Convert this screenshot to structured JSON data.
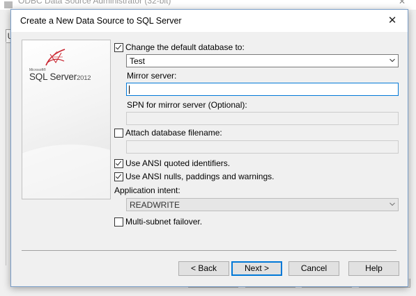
{
  "background_window": {
    "title": "ODBC Data Source Administrator (32-bit)",
    "tab_glyph": "U",
    "close_glyph": "✕"
  },
  "dialog": {
    "title": "Create a New Data Source to SQL Server",
    "close_glyph": "✕"
  },
  "logo": {
    "small": "Microsoft®",
    "main": "SQL Server",
    "year": "2012",
    "icon": "sql-server-logo-icon"
  },
  "form": {
    "change_default_db": {
      "label": "Change the default database to:",
      "checked": true
    },
    "database": {
      "value": "Test"
    },
    "mirror_server": {
      "label": "Mirror server:",
      "value": ""
    },
    "spn": {
      "label": "SPN for mirror server (Optional):",
      "value": ""
    },
    "attach_db": {
      "label": "Attach database filename:",
      "checked": false
    },
    "attach_db_path": {
      "value": ""
    },
    "ansi_quoted": {
      "label": "Use ANSI quoted identifiers.",
      "checked": true
    },
    "ansi_nulls": {
      "label": "Use ANSI nulls, paddings and warnings.",
      "checked": true
    },
    "app_intent": {
      "label": "Application intent:",
      "value": "READWRITE"
    },
    "multi_subnet": {
      "label": "Multi-subnet failover.",
      "checked": false
    }
  },
  "buttons": {
    "back": "< Back",
    "next": "Next >",
    "cancel": "Cancel",
    "help": "Help"
  },
  "colors": {
    "focus_accent": "#0078d7",
    "logo_red": "#c8202b"
  }
}
